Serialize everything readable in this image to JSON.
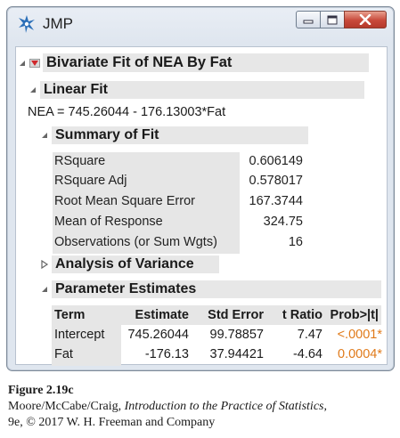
{
  "window": {
    "title": "JMP"
  },
  "report": {
    "main_title": "Bivariate Fit of NEA By Fat",
    "linear_fit": {
      "title": "Linear Fit",
      "equation": "NEA = 745.26044 - 176.13003*Fat"
    },
    "summary_of_fit": {
      "title": "Summary of Fit",
      "rows": [
        {
          "label": "RSquare",
          "value": "0.606149"
        },
        {
          "label": "RSquare Adj",
          "value": "0.578017"
        },
        {
          "label": "Root Mean Square Error",
          "value": "167.3744"
        },
        {
          "label": "Mean of Response",
          "value": "324.75"
        },
        {
          "label": "Observations (or Sum Wgts)",
          "value": "16"
        }
      ]
    },
    "analysis_of_variance": {
      "title": "Analysis of Variance"
    },
    "parameter_estimates": {
      "title": "Parameter Estimates",
      "headers": [
        "Term",
        "Estimate",
        "Std Error",
        "t Ratio",
        "Prob>|t|"
      ],
      "rows": [
        {
          "term": "Intercept",
          "estimate": "745.26044",
          "std_error": "99.78857",
          "t_ratio": "7.47",
          "prob": "<.0001*"
        },
        {
          "term": "Fat",
          "estimate": "-176.13",
          "std_error": "37.94421",
          "t_ratio": "-4.64",
          "prob": "0.0004*"
        }
      ]
    }
  },
  "caption": {
    "figure": "Figure 2.19c",
    "line1_prefix": "Moore/McCabe/Craig, ",
    "line1_italic": "Introduction to the Practice of Statistics",
    "line1_suffix": ",",
    "line2": "9e, © 2017 W. H. Freeman and Company"
  },
  "colors": {
    "significant_prob": "#e07a1a",
    "menu_triangle": "#d0272a"
  }
}
